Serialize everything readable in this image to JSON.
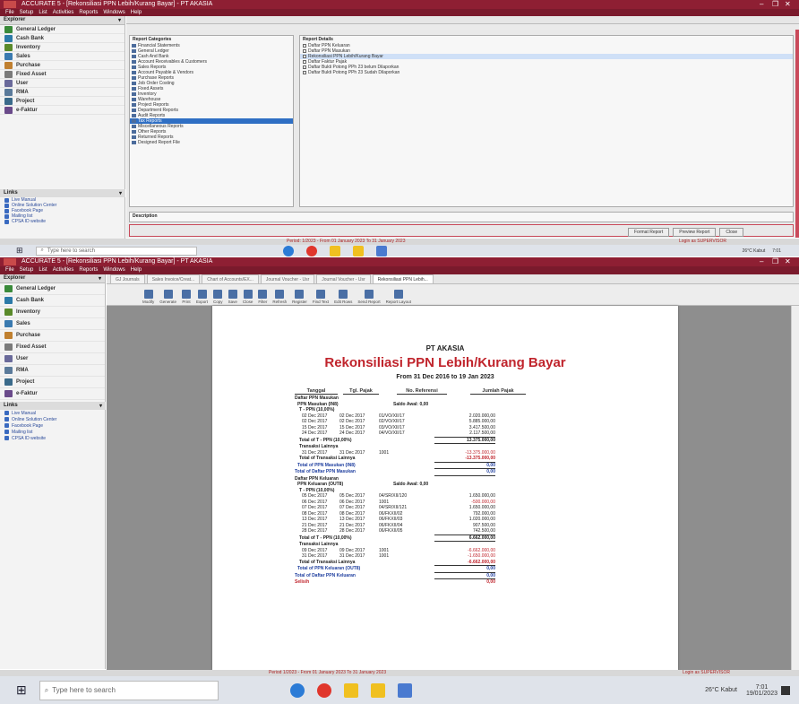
{
  "top_window": {
    "title": "ACCURATE 5 - [Rekonsiliasi PPN Lebih/Kurang Bayar] - PT AKASIA",
    "menu": [
      "File",
      "Setup",
      "List",
      "Activities",
      "Reports",
      "Windows",
      "Help"
    ],
    "explorer_title": "Explorer",
    "nav": [
      {
        "label": "General Ledger",
        "color": "#3a8a3a"
      },
      {
        "label": "Cash Bank",
        "color": "#2c7aa8"
      },
      {
        "label": "Inventory",
        "color": "#5a8a2a"
      },
      {
        "label": "Sales",
        "color": "#3a7ab0"
      },
      {
        "label": "Purchase",
        "color": "#c08030"
      },
      {
        "label": "Fixed Asset",
        "color": "#7a7a7a"
      },
      {
        "label": "User",
        "color": "#6a6a9a"
      },
      {
        "label": "RMA",
        "color": "#5a7a9a"
      },
      {
        "label": "Project",
        "color": "#3a6a8a"
      },
      {
        "label": "e-Faktur",
        "color": "#6a4a8a"
      }
    ],
    "links_title": "Links",
    "links": [
      "Live Manual",
      "Online Solution Center",
      "Facebook Page",
      "Mailing list",
      "CPSA ID website"
    ],
    "report_categories_title": "Report Categories",
    "report_categories": [
      "Financial Statements",
      "General Ledger",
      "Cash And Bank",
      "Account Receivables & Customers",
      "Sales Reports",
      "Account Payable & Vendors",
      "Purchase Reports",
      "Job Order Costing",
      "Fixed Assets",
      "Inventory",
      "Warehouse",
      "Project Reports",
      "Department Reports",
      "Audit Reports",
      "Tax Reports",
      "Miscellaneous Reports",
      "Other Reports",
      "Returned Reports",
      "Designed Report File"
    ],
    "selected_category_index": 14,
    "report_list_title": "Report Details",
    "report_list": [
      "Daftar PPN Keluaran",
      "Daftar PPN Masukan",
      "Rekonsiliasi PPN Lebih/Kurang Bayar",
      "Daftar Faktur Pajak",
      "Daftar Bukti Potong PPh 23 belum Dilaporkan",
      "Daftar Bukti Potong PPh 23 Sudah Dilaporkan"
    ],
    "selected_report_index": 2,
    "description_title": "Description",
    "buttons": [
      "Format Report",
      "Preview Report",
      "Close"
    ],
    "status": "Period: 1/2023 - From 01 January 2023 To 31 January 2023",
    "login": "Login as SUPERVISOR"
  },
  "bottom_window": {
    "title": "ACCURATE 5 - [Rekonsiliasi PPN Lebih/Kurang Bayar] - PT AKASIA",
    "menu": [
      "File",
      "Setup",
      "List",
      "Activities",
      "Reports",
      "Windows",
      "Help"
    ],
    "explorer_title": "Explorer",
    "tabs": [
      "GJ Journals",
      "Sales Invoice/Creat...",
      "Chart of Accounts/EX...",
      "Journal Voucher - Usr",
      "Journal Voucher - Usr",
      "Rekonsiliasi PPN Lebih..."
    ],
    "toolbar": [
      "Modify",
      "Generate",
      "Print",
      "Export",
      "Copy",
      "Save",
      "Close",
      "Filter",
      "Refresh",
      "Register",
      "Find Text",
      "Edit Rows",
      "Send Report",
      "Report Layout"
    ],
    "nav": [
      {
        "label": "General Ledger",
        "color": "#3a8a3a"
      },
      {
        "label": "Cash Bank",
        "color": "#2c7aa8"
      },
      {
        "label": "Inventory",
        "color": "#5a8a2a"
      },
      {
        "label": "Sales",
        "color": "#3a7ab0"
      },
      {
        "label": "Purchase",
        "color": "#c08030"
      },
      {
        "label": "Fixed Asset",
        "color": "#7a7a7a"
      },
      {
        "label": "User",
        "color": "#6a6a9a"
      },
      {
        "label": "RMA",
        "color": "#5a7a9a"
      },
      {
        "label": "Project",
        "color": "#3a6a8a"
      },
      {
        "label": "e-Faktur",
        "color": "#6a4a8a"
      }
    ],
    "links_title": "Links",
    "links": [
      "Live Manual",
      "Online Solution Center",
      "Facebook Page",
      "Mailing list",
      "CPSA ID website"
    ],
    "status": "Period 1/2023 - From 01 January 2023 To 31 January 2023",
    "login": "Login as SUPERVISOR"
  },
  "report": {
    "company": "PT AKASIA",
    "title": "Rekonsiliasi PPN Lebih/Kurang Bayar",
    "period": "From 31 Dec 2016 to 19 Jan 2023",
    "columns": [
      "Tanggal",
      "Tgl. Pajak",
      "No. Referensi",
      "Jumlah Pajak"
    ],
    "rows": [
      {
        "t": "Daftar PPN Masukan",
        "k": "h0"
      },
      {
        "t": "PPN Masukan (IN8)",
        "k": "h1",
        "ref": "Saldo Awal: 0,00"
      },
      {
        "t": "T - PPN (10,00%)",
        "k": "h2"
      },
      {
        "t": "02 Dec 2017",
        "tp": "02 Dec 2017",
        "ref": "01/VO/XII/17",
        "amt": "2.020.000,00",
        "k": "d"
      },
      {
        "t": "02 Dec 2017",
        "tp": "02 Dec 2017",
        "ref": "02/VO/XII/17",
        "amt": "5.885.000,00",
        "k": "d"
      },
      {
        "t": "15 Dec 2017",
        "tp": "15 Dec 2017",
        "ref": "03/VO/XII/17",
        "amt": "3.417.500,00",
        "k": "d"
      },
      {
        "t": "24 Dec 2017",
        "tp": "24 Dec 2017",
        "ref": "04/VO/XII/17",
        "amt": "2.117.500,00",
        "k": "du"
      },
      {
        "t": "Total of T - PPN (10,00%)",
        "amt": "13.375.000,00",
        "k": "tot"
      },
      {
        "t": "Transaksi Lainnya",
        "k": "h2"
      },
      {
        "t": "31 Dec 2017",
        "tp": "31 Dec 2017",
        "ref": "1001",
        "amt": "-13.375.000,00",
        "k": "dr"
      },
      {
        "t": "Total of Transaksi Lainnya",
        "amt": "-13.375.000,00",
        "k": "totr"
      },
      {
        "t": "Total of PPN Masukan (IN8)",
        "amt": "0,00",
        "k": "tot1"
      },
      {
        "t": "Total of Daftar PPN Masukan",
        "amt": "0,00",
        "k": "tot0"
      },
      {
        "t": "Daftar PPN Keluaran",
        "k": "h0"
      },
      {
        "t": "PPN Keluaran (OUT8)",
        "k": "h1",
        "ref": "Saldo Awal: 0,00"
      },
      {
        "t": "T - PPN (10,00%)",
        "k": "h2"
      },
      {
        "t": "05 Dec 2017",
        "tp": "05 Dec 2017",
        "ref": "04/SR/XII/120",
        "amt": "1.650.000,00",
        "k": "d"
      },
      {
        "t": "06 Dec 2017",
        "tp": "06 Dec 2017",
        "ref": "1001",
        "amt": "-500.000,00",
        "k": "dr"
      },
      {
        "t": "07 Dec 2017",
        "tp": "07 Dec 2017",
        "ref": "04/SR/XII/121",
        "amt": "1.650.000,00",
        "k": "d"
      },
      {
        "t": "08 Dec 2017",
        "tp": "08 Dec 2017",
        "ref": "06/FKXII/02",
        "amt": "792.000,00",
        "k": "d"
      },
      {
        "t": "13 Dec 2017",
        "tp": "13 Dec 2017",
        "ref": "06/FKXII/03",
        "amt": "1.020.000,00",
        "k": "d"
      },
      {
        "t": "21 Dec 2017",
        "tp": "21 Dec 2017",
        "ref": "06/FKXII/04",
        "amt": "907.500,00",
        "k": "d"
      },
      {
        "t": "28 Dec 2017",
        "tp": "28 Dec 2017",
        "ref": "06/FKXII/05",
        "amt": "742.500,00",
        "k": "du"
      },
      {
        "t": "Total of T - PPN (10,00%)",
        "amt": "6.662.000,00",
        "k": "tot"
      },
      {
        "t": "Transaksi Lainnya",
        "k": "h2"
      },
      {
        "t": "09 Dec 2017",
        "tp": "09 Dec 2017",
        "ref": "1001",
        "amt": "-6.662.000,00",
        "k": "dr"
      },
      {
        "t": "31 Dec 2017",
        "tp": "31 Dec 2017",
        "ref": "1001",
        "amt": "-1.650.000,00",
        "k": "dr"
      },
      {
        "t": "Total of Transaksi Lainnya",
        "amt": "-6.662.000,00",
        "k": "totr"
      },
      {
        "t": "Total of PPN Keluaran (OUT8)",
        "amt": "0,00",
        "k": "tot1"
      },
      {
        "t": "Total of Daftar PPN Keluaran",
        "amt": "0,00",
        "k": "tot0"
      },
      {
        "t": "Selisih",
        "amt": "0,00",
        "k": "net"
      }
    ]
  },
  "taskbar": {
    "search_placeholder": "Type here to search",
    "weather": "26°C Kabut",
    "time": "7:01",
    "date": "19/01/2023"
  }
}
